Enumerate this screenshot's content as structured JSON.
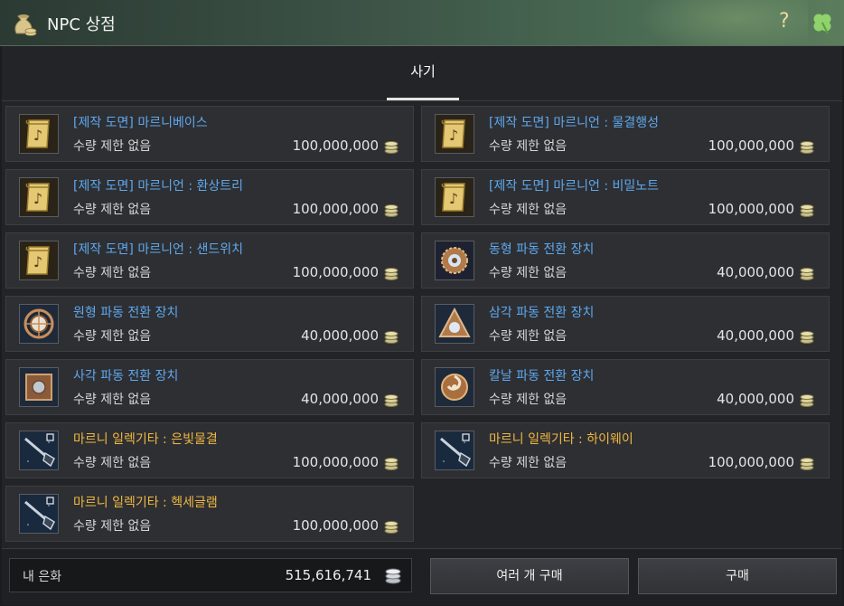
{
  "window": {
    "title": "NPC 상점",
    "help_icon": "?"
  },
  "tabs": [
    {
      "label": "사기",
      "active": true
    }
  ],
  "items": [
    {
      "name": "[제작 도면] 마르니베이스",
      "limit": "수량 제한 없음",
      "price": "100,000,000",
      "color": "blue",
      "icon": "scroll-icon"
    },
    {
      "name": "[제작 도면] 마르니언 : 물결행성",
      "limit": "수량 제한 없음",
      "price": "100,000,000",
      "color": "blue",
      "icon": "scroll-icon"
    },
    {
      "name": "[제작 도면] 마르니언 : 환상트리",
      "limit": "수량 제한 없음",
      "price": "100,000,000",
      "color": "blue",
      "icon": "scroll-icon"
    },
    {
      "name": "[제작 도면] 마르니언 : 비밀노트",
      "limit": "수량 제한 없음",
      "price": "100,000,000",
      "color": "blue",
      "icon": "scroll-icon"
    },
    {
      "name": "[제작 도면] 마르니언 : 샌드위치",
      "limit": "수량 제한 없음",
      "price": "100,000,000",
      "color": "blue",
      "icon": "scroll-icon"
    },
    {
      "name": "동형 파동 전환 장치",
      "limit": "수량 제한 없음",
      "price": "40,000,000",
      "color": "blue",
      "icon": "gear-device-icon"
    },
    {
      "name": "원형 파동 전환 장치",
      "limit": "수량 제한 없음",
      "price": "40,000,000",
      "color": "blue",
      "icon": "circle-device-icon"
    },
    {
      "name": "삼각 파동 전환 장치",
      "limit": "수량 제한 없음",
      "price": "40,000,000",
      "color": "blue",
      "icon": "triangle-device-icon"
    },
    {
      "name": "사각 파동 전환 장치",
      "limit": "수량 제한 없음",
      "price": "40,000,000",
      "color": "blue",
      "icon": "square-device-icon"
    },
    {
      "name": "칼날 파동 전환 장치",
      "limit": "수량 제한 없음",
      "price": "40,000,000",
      "color": "blue",
      "icon": "blade-device-icon"
    },
    {
      "name": "마르니 일렉기타 : 은빛물결",
      "limit": "수량 제한 없음",
      "price": "100,000,000",
      "color": "gold",
      "icon": "guitar-icon"
    },
    {
      "name": "마르니 일렉기타 : 하이웨이",
      "limit": "수량 제한 없음",
      "price": "100,000,000",
      "color": "gold",
      "icon": "guitar-icon"
    },
    {
      "name": "마르니 일렉기타 : 헥세글램",
      "limit": "수량 제한 없음",
      "price": "100,000,000",
      "color": "gold",
      "icon": "guitar-icon"
    }
  ],
  "footer": {
    "money_label": "내 은화",
    "money_value": "515,616,741",
    "multi_buy_label": "여러 개 구매",
    "buy_label": "구매"
  },
  "colors": {
    "blue_text": "#5ea8ee",
    "gold_text": "#f0b840",
    "title_gradient_end": "#5b7d5c"
  }
}
